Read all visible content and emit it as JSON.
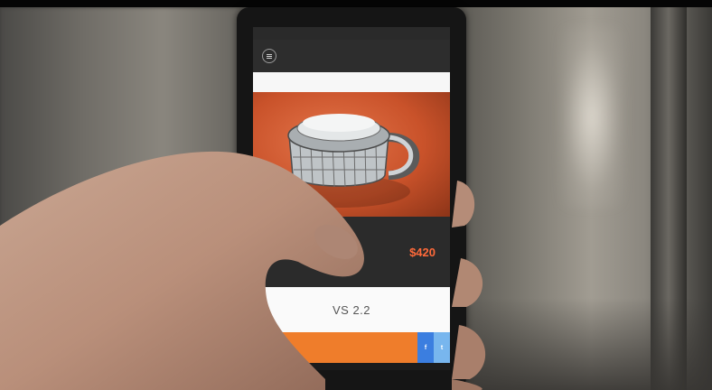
{
  "colors": {
    "accent": "#ef7d2b",
    "price": "#ff6a3a",
    "hero": "#c9522a",
    "facebook": "#3b7ee0",
    "twitter": "#78b6ee",
    "navbar": "#2d2d2d"
  },
  "icons": {
    "menu": "menu-icon",
    "facebook": "facebook-icon",
    "twitter": "twitter-icon"
  },
  "app": {
    "title": "",
    "status_time": "",
    "status_carrier": "",
    "status_battery": ""
  },
  "product": {
    "info_label": "",
    "price": "$420",
    "name": "VS 2.2"
  },
  "actions": {
    "main_label": "",
    "facebook_label": "f",
    "twitter_label": "t"
  }
}
